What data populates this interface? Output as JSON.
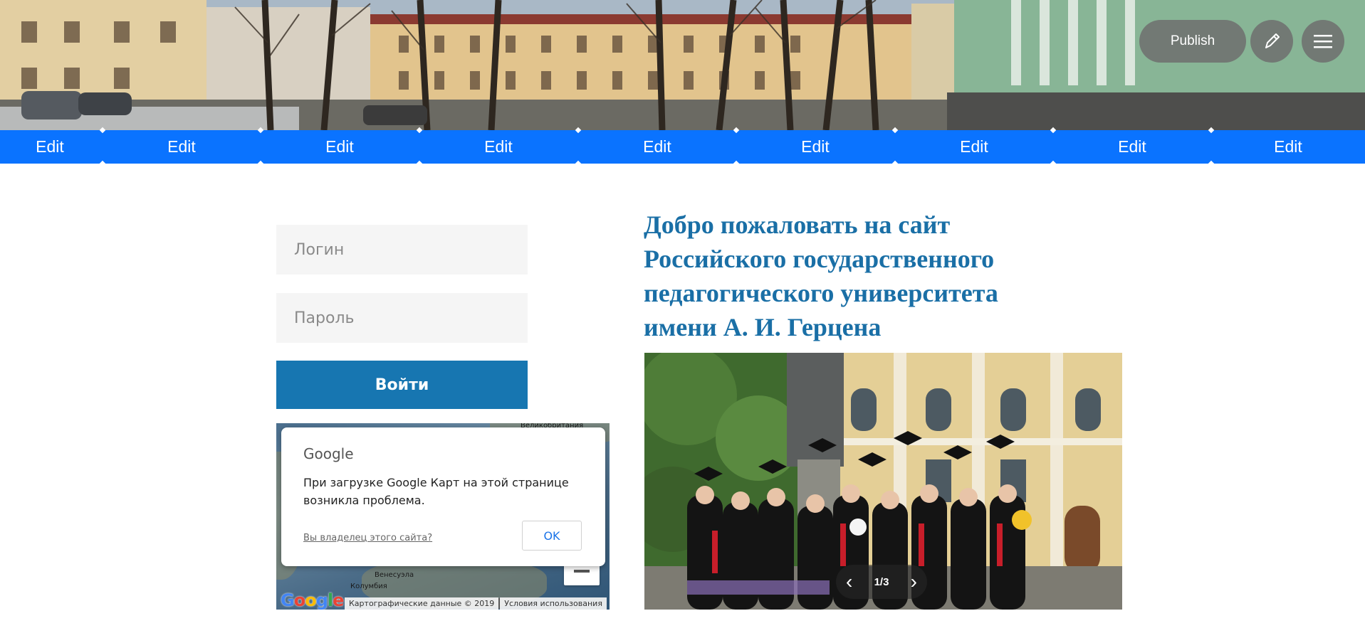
{
  "toolbar": {
    "publish_label": "Publish"
  },
  "edit_strip": {
    "labels": [
      "Edit",
      "Edit",
      "Edit",
      "Edit",
      "Edit",
      "Edit",
      "Edit",
      "Edit",
      "Edit"
    ]
  },
  "login_form": {
    "login_placeholder": "Логин",
    "password_placeholder": "Пароль",
    "submit_label": "Войти"
  },
  "map": {
    "dialog_brand": "Google",
    "error_message": "При загрузке Google Карт на этой странице возникла проблема.",
    "owner_link": "Вы владелец этого сайта?",
    "ok_label": "OK",
    "place_labels": [
      "Великобритания",
      "Венесуэла",
      "Колумбия"
    ],
    "footer_data": "Картографические данные © 2019",
    "footer_terms": "Условия использования",
    "logo_text": "Google"
  },
  "main": {
    "heading": "Добро пожаловать на сайт Российского государственного педагогического университета имени А. И. Герцена"
  },
  "slideshow": {
    "counter": "1/3",
    "prev_icon": "chevron-left-icon",
    "next_icon": "chevron-right-icon"
  },
  "colors": {
    "edit_strip": "#0a73ff",
    "primary_button": "#1776b1",
    "heading": "#1a6fa6"
  }
}
